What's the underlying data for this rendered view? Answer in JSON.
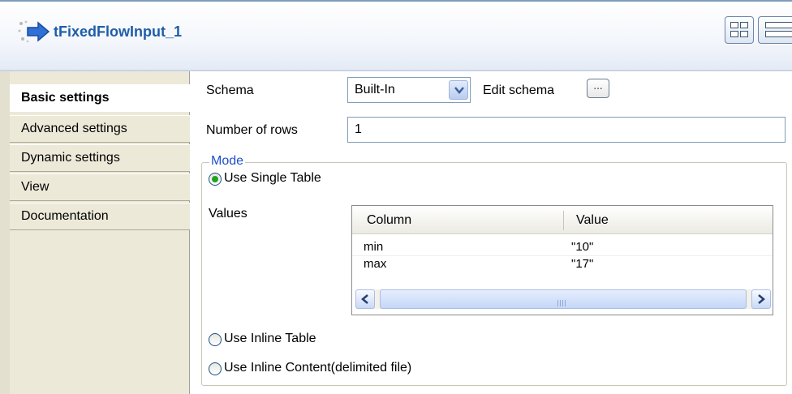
{
  "header": {
    "title": "tFixedFlowInput_1"
  },
  "sidebar": {
    "tabs": [
      {
        "label": "Basic settings",
        "active": true
      },
      {
        "label": "Advanced settings",
        "active": false
      },
      {
        "label": "Dynamic settings",
        "active": false
      },
      {
        "label": "View",
        "active": false
      },
      {
        "label": "Documentation",
        "active": false
      }
    ]
  },
  "form": {
    "schema_label": "Schema",
    "schema_value": "Built-In",
    "edit_schema_label": "Edit schema",
    "edit_schema_button": "...",
    "rows_label": "Number of rows",
    "rows_value": "1"
  },
  "mode": {
    "legend": "Mode",
    "use_single_table": "Use Single Table",
    "values_label": "Values",
    "use_inline_table": "Use Inline Table",
    "use_inline_content": "Use Inline Content(delimited file)",
    "selected": "use_single_table"
  },
  "values_table": {
    "headers": [
      "Column",
      "Value"
    ],
    "rows": [
      [
        "min",
        "\"10\""
      ],
      [
        "max",
        "\"17\""
      ]
    ]
  },
  "colors": {
    "title": "#1f5da8",
    "legend": "#1e50c8",
    "radio_selected": "#21a121",
    "sidebar_bg": "#ece9d8"
  }
}
